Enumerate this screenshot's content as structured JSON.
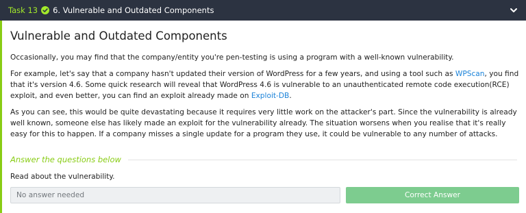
{
  "header": {
    "task_label": "Task 13",
    "task_title": "6. Vulnerable and Outdated Components",
    "status_icon": "check-circle-icon",
    "expand_icon": "chevron-down-icon",
    "background_color": "#2c3341",
    "accent_color": "#a3ea2a"
  },
  "content": {
    "title": "Vulnerable and Outdated Components",
    "para1": "Occasionally, you may find that the company/entity you're pen-testing is using a program with a well-known vulnerability.",
    "para2": {
      "before_link1": "For example, let's say that a company hasn't updated their version of WordPress for a few years, and using a tool such as ",
      "link1": "WPScan",
      "middle": ", you find that it's version 4.6. Some quick research will reveal that WordPress 4.6 is vulnerable to an unauthenticated remote code execution(RCE) exploit, and even better, you can find an exploit already made on ",
      "link2": "Exploit-DB",
      "after_link2": "."
    },
    "para3": "As you can see, this would be quite devastating because it requires very little work on the attacker's part. Since the vulnerability is already well known, someone else has likely made an exploit for the vulnerability already. The situation worsens when you realise that it's really easy for this to happen. If a company misses a single update for a program they use, it could be vulnerable to any number of attacks.",
    "link_color": "#1a82d9"
  },
  "answer_section": {
    "heading": "Answer the questions below",
    "question": "Read about the vulnerability.",
    "input_placeholder": "No answer needed",
    "button_label": "Correct Answer",
    "accent_color": "#88cc14",
    "button_color": "#7dcc8f"
  }
}
